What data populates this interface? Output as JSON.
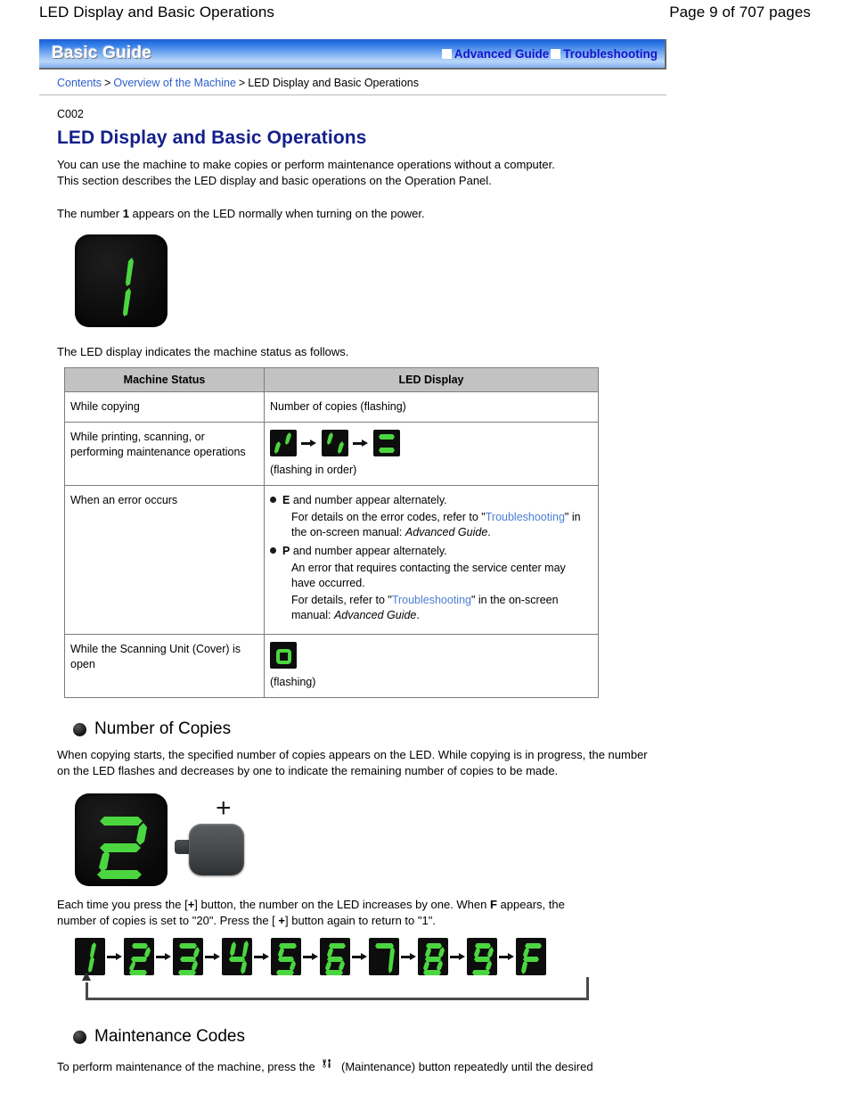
{
  "page_header": {
    "title": "LED Display and Basic Operations",
    "page_number": "Page 9 of 707 pages"
  },
  "guide_bar": {
    "title": "Basic Guide",
    "links": [
      {
        "label": "Advanced Guide",
        "icon": "white-square-icon"
      },
      {
        "label": "Troubleshooting",
        "icon": "white-square-icon"
      }
    ]
  },
  "breadcrumb": {
    "items": [
      {
        "label": "Contents",
        "link": true
      },
      {
        "label": "Overview of the Machine",
        "link": true
      },
      {
        "label": "LED Display and Basic Operations",
        "link": false
      }
    ],
    "separator": ">"
  },
  "document": {
    "code": "C002",
    "title": "LED Display and Basic Operations",
    "intro_line1": "You can use the machine to make copies or perform maintenance operations without a computer.",
    "intro_line2": "This section describes the LED display and basic operations on the Operation Panel.",
    "power_on_note_pre": "The number ",
    "power_on_note_bold": "1",
    "power_on_note_post": " appears on the LED normally when turning on the power.",
    "led_power_on_value": "1",
    "table_lead": "The LED display indicates the machine status as follows."
  },
  "status_table": {
    "headers": [
      "Machine Status",
      "LED Display"
    ],
    "rows": [
      {
        "status": "While copying",
        "display_text": "Number of copies (flashing)",
        "type": "text"
      },
      {
        "status": "While printing, scanning, or performing maintenance operations",
        "type": "led-sequence",
        "led_frames": [
          "seg-a",
          "seg-b",
          "seg-c"
        ],
        "note": "(flashing in order)"
      },
      {
        "status": "When an error occurs",
        "type": "error-list",
        "items": [
          {
            "code": "E",
            "head_rest": " and number appear alternately.",
            "details": [
              {
                "pre": "For details on the error codes, refer to \"",
                "link": "Troubleshooting",
                "mid": "\" in the on-screen manual: ",
                "italic": "Advanced Guide",
                "post": "."
              }
            ]
          },
          {
            "code": "P",
            "head_rest": " and number appear alternately.",
            "details": [
              {
                "pre": "An error that requires contacting the service center may have occurred.",
                "link": "",
                "mid": "",
                "italic": "",
                "post": ""
              },
              {
                "pre": "For details, refer to \"",
                "link": "Troubleshooting",
                "mid": "\" in the on-screen manual: ",
                "italic": "Advanced Guide",
                "post": "."
              }
            ]
          }
        ]
      },
      {
        "status": "While the Scanning Unit (Cover) is open",
        "type": "led-single",
        "led_value": "o",
        "note": "(flashing)"
      }
    ]
  },
  "sections": [
    {
      "heading": "Number of Copies",
      "paragraph": "When copying starts, the specified number of copies appears on the LED. While copying is in progress, the number on the LED flashes and decreases by one to indicate the remaining number of copies to be made.",
      "figure": {
        "led_value": "2",
        "plus_symbol": "+",
        "button_name": "plus-button"
      },
      "after_fig_line1_pre": "Each time you press the [",
      "after_fig_line1_btn": "+",
      "after_fig_line1_mid": "] button, the number on the LED increases by one. When ",
      "after_fig_line1_bold": "F",
      "after_fig_line1_post": " appears, the",
      "after_fig_line2_pre": "number of copies is set to \"20\". Press the [ ",
      "after_fig_line2_btn": "+",
      "after_fig_line2_post": "] button again to return to \"1\"."
    },
    {
      "heading": "Maintenance Codes",
      "paragraph_pre": "To perform maintenance of the machine, press the ",
      "paragraph_icon": "maintenance-tool-icon",
      "paragraph_post": " (Maintenance) button repeatedly until the desired"
    }
  ],
  "copy_sequence": {
    "values": [
      "1",
      "2",
      "3",
      "4",
      "5",
      "6",
      "7",
      "8",
      "9",
      "F"
    ],
    "arrow": "→",
    "loop_back": true
  },
  "colors": {
    "led_green": "#4bd640",
    "led_background": "#0d0d0d",
    "title_blue": "#141f8c",
    "link_blue": "#2c5fc9",
    "guide_link_blue": "#1414cc",
    "table_header_gray": "#c2c2c2",
    "table_border": "#7d7d7d"
  }
}
